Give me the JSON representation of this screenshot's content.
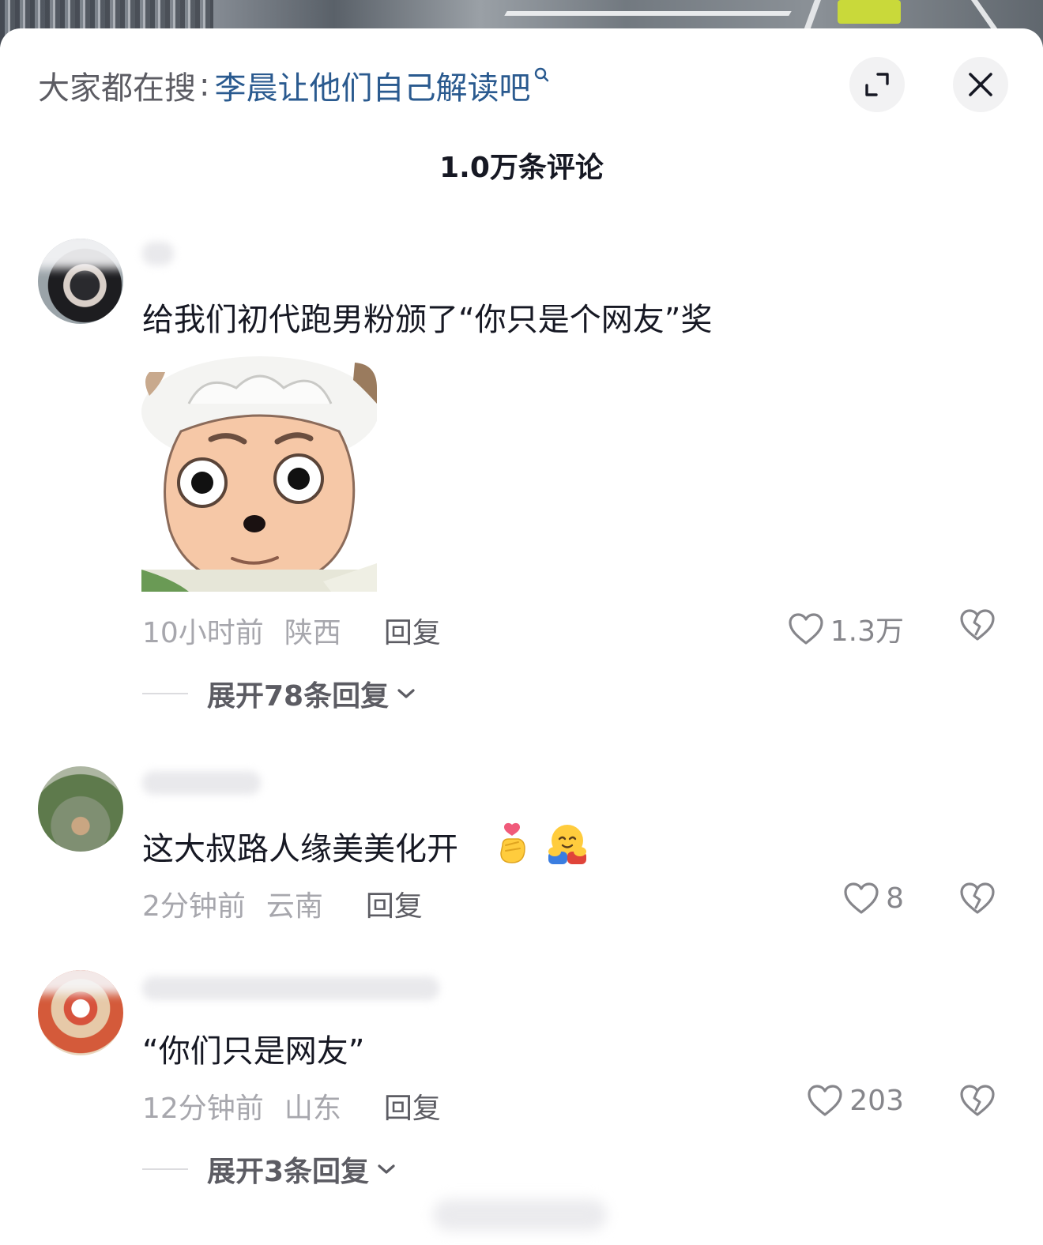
{
  "search_hint": {
    "prefix": "大家都在搜",
    "separator": ":",
    "term": "李晨让他们自己解读吧"
  },
  "header": {
    "comment_count": "1.0万条评论",
    "expand_icon": "expand-icon",
    "close_icon": "close-icon"
  },
  "comments": [
    {
      "text": "给我们初代跑男粉颁了“你只是个网友”奖",
      "sticker": "sheep-sticker",
      "time": "10小时前",
      "location": "陕西",
      "reply_label": "回复",
      "likes": "1.3万",
      "expand_replies": "展开78条回复"
    },
    {
      "text": "这大叔路人缘美美化开",
      "emojis": [
        "finger-heart-emoji",
        "hugging-face-emoji"
      ],
      "time": "2分钟前",
      "location": "云南",
      "reply_label": "回复",
      "likes": "8"
    },
    {
      "text": "“你们只是网友”",
      "time": "12分钟前",
      "location": "山东",
      "reply_label": "回复",
      "likes": "203",
      "expand_replies": "展开3条回复"
    }
  ],
  "colors": {
    "search_term": "#2a5a8f",
    "primary_text": "#161823",
    "secondary_text": "#a7a7ad",
    "reply_text": "#5c5c63"
  }
}
